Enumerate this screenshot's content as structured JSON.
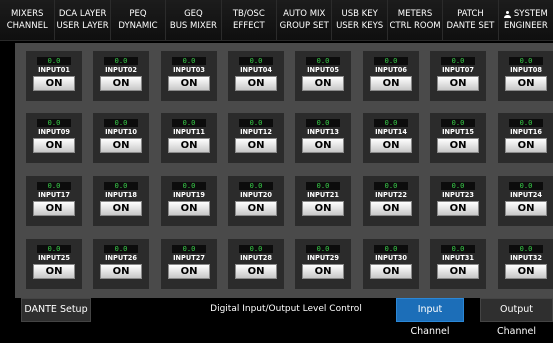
{
  "nav": [
    {
      "line1": "MIXERS",
      "line2": "CHANNEL"
    },
    {
      "line1": "DCA LAYER",
      "line2": "USER LAYER"
    },
    {
      "line1": "PEQ",
      "line2": "DYNAMIC"
    },
    {
      "line1": "GEQ",
      "line2": "BUS MIXER"
    },
    {
      "line1": "TB/OSC",
      "line2": "EFFECT"
    },
    {
      "line1": "AUTO MIX",
      "line2": "GROUP SET"
    },
    {
      "line1": "USB KEY",
      "line2": "USER KEYS"
    },
    {
      "line1": "METERS",
      "line2": "CTRL ROOM"
    },
    {
      "line1": "PATCH",
      "line2": "DANTE SET"
    },
    {
      "line1": "SYSTEM",
      "line2": "ENGINEER",
      "icon": "user-icon"
    }
  ],
  "channels": [
    {
      "name": "INPUT01",
      "level": "0.0",
      "state": "ON"
    },
    {
      "name": "INPUT02",
      "level": "0.0",
      "state": "ON"
    },
    {
      "name": "INPUT03",
      "level": "0.0",
      "state": "ON"
    },
    {
      "name": "INPUT04",
      "level": "0.0",
      "state": "ON"
    },
    {
      "name": "INPUT05",
      "level": "0.0",
      "state": "ON"
    },
    {
      "name": "INPUT06",
      "level": "0.0",
      "state": "ON"
    },
    {
      "name": "INPUT07",
      "level": "0.0",
      "state": "ON"
    },
    {
      "name": "INPUT08",
      "level": "0.0",
      "state": "ON"
    },
    {
      "name": "INPUT09",
      "level": "0.0",
      "state": "ON"
    },
    {
      "name": "INPUT10",
      "level": "0.0",
      "state": "ON"
    },
    {
      "name": "INPUT11",
      "level": "0.0",
      "state": "ON"
    },
    {
      "name": "INPUT12",
      "level": "0.0",
      "state": "ON"
    },
    {
      "name": "INPUT13",
      "level": "0.0",
      "state": "ON"
    },
    {
      "name": "INPUT14",
      "level": "0.0",
      "state": "ON"
    },
    {
      "name": "INPUT15",
      "level": "0.0",
      "state": "ON"
    },
    {
      "name": "INPUT16",
      "level": "0.0",
      "state": "ON"
    },
    {
      "name": "INPUT17",
      "level": "0.0",
      "state": "ON"
    },
    {
      "name": "INPUT18",
      "level": "0.0",
      "state": "ON"
    },
    {
      "name": "INPUT19",
      "level": "0.0",
      "state": "ON"
    },
    {
      "name": "INPUT20",
      "level": "0.0",
      "state": "ON"
    },
    {
      "name": "INPUT21",
      "level": "0.0",
      "state": "ON"
    },
    {
      "name": "INPUT22",
      "level": "0.0",
      "state": "ON"
    },
    {
      "name": "INPUT23",
      "level": "0.0",
      "state": "ON"
    },
    {
      "name": "INPUT24",
      "level": "0.0",
      "state": "ON"
    },
    {
      "name": "INPUT25",
      "level": "0.0",
      "state": "ON"
    },
    {
      "name": "INPUT26",
      "level": "0.0",
      "state": "ON"
    },
    {
      "name": "INPUT27",
      "level": "0.0",
      "state": "ON"
    },
    {
      "name": "INPUT28",
      "level": "0.0",
      "state": "ON"
    },
    {
      "name": "INPUT29",
      "level": "0.0",
      "state": "ON"
    },
    {
      "name": "INPUT30",
      "level": "0.0",
      "state": "ON"
    },
    {
      "name": "INPUT31",
      "level": "0.0",
      "state": "ON"
    },
    {
      "name": "INPUT32",
      "level": "0.0",
      "state": "ON"
    }
  ],
  "bottom": {
    "dante_setup": "DANTE Setup",
    "title": "Digital Input/Output Level Control",
    "input_channel": "Input Channel",
    "output_channel": "Output Channel"
  },
  "colors": {
    "active_tab": "#1c6eb8",
    "level_text": "#39d14a",
    "panel_bg": "#4a4a4a"
  }
}
